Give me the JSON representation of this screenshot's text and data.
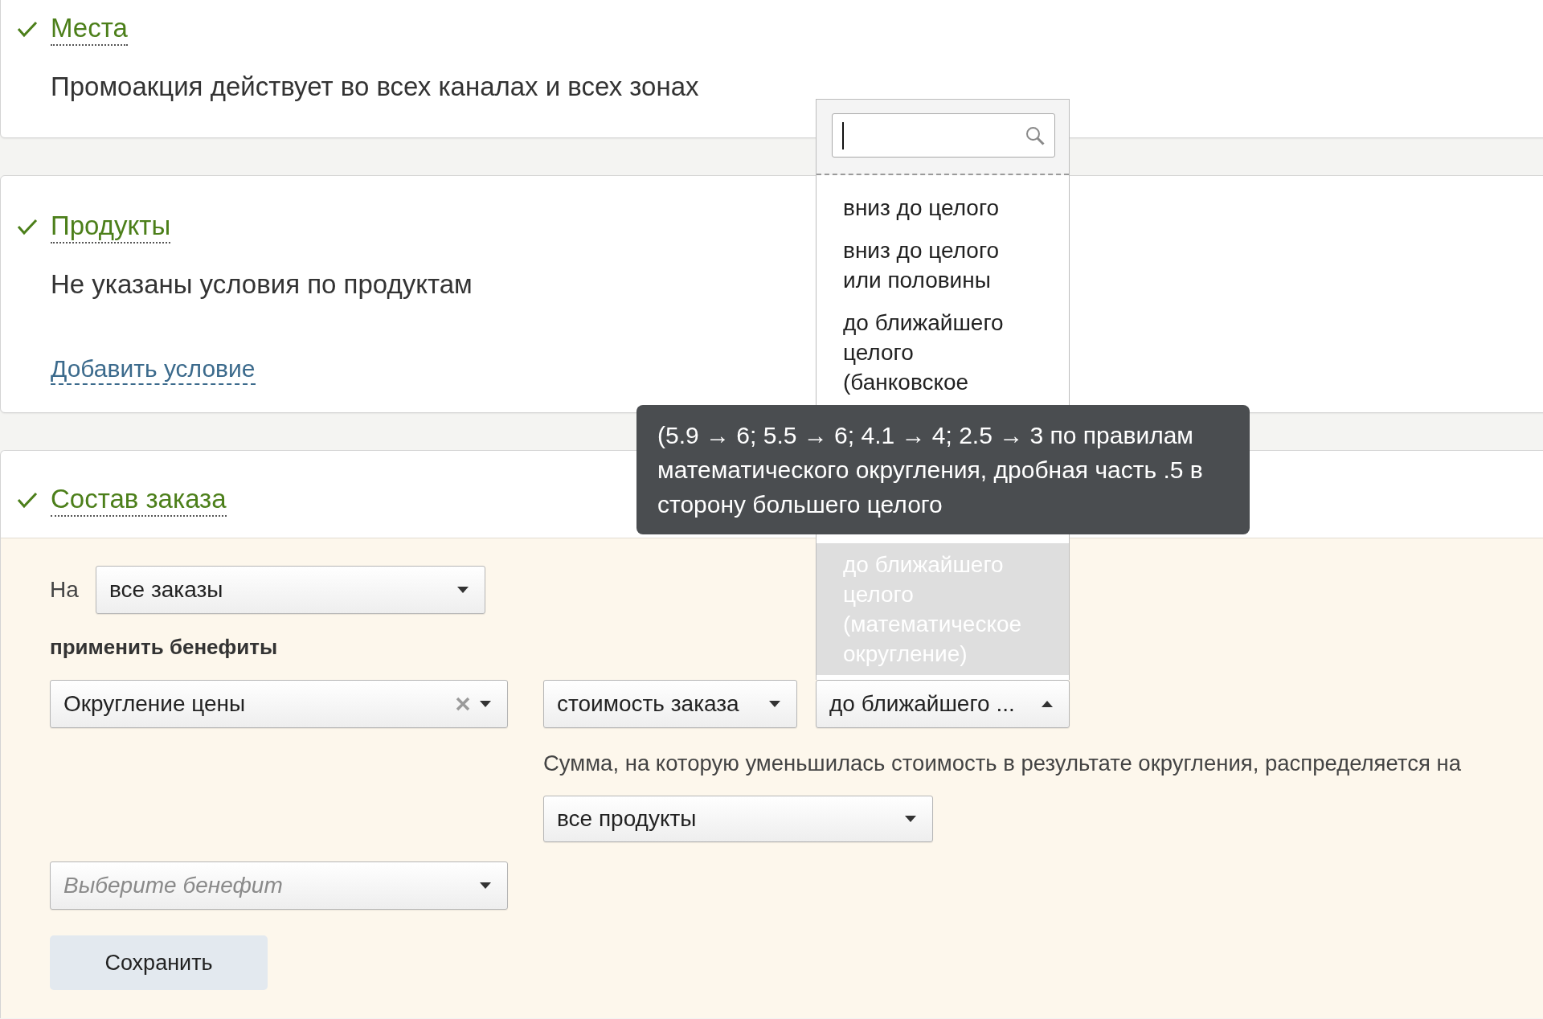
{
  "sections": [
    {
      "title": "Места",
      "complete": true,
      "description": "Промоакция действует во всех каналах и всех зонах"
    },
    {
      "title": "Продукты",
      "complete": true,
      "description": "Не указаны условия по продуктам",
      "link": "Добавить условие"
    },
    {
      "title": "Состав заказа",
      "complete": true,
      "form": {
        "scope_label": "На",
        "scope_select": {
          "value": "все заказы"
        },
        "benefits_label": "применить бенефиты",
        "benefits": [
          {
            "type_select": {
              "value": "Округление цены",
              "clearable": true
            },
            "base_select": {
              "value": "стоимость заказа"
            },
            "rounding_select": {
              "value": "до ближайшего ...",
              "open": true,
              "search": {
                "focused": true
              },
              "options": [
                {
                  "label": "вниз до целого",
                  "selected": false
                },
                {
                  "label": "вниз до целого или половины",
                  "selected": false
                },
                {
                  "label": "до ближайшего целого (банковское",
                  "selected": false
                },
                {
                  "label": "до ближайшего целого (математическое округление)",
                  "selected": true
                }
              ]
            },
            "note": "Сумма, на которую уменьшилась стоимость в результате округления, распределяется на",
            "distribution_select": {
              "value": "все продукты"
            }
          }
        ],
        "new_benefit_select": {
          "placeholder": "Выберите бенефит"
        },
        "save_button": "Сохранить"
      }
    }
  ],
  "tooltip": {
    "text": "(5.9 → 6; 5.5 → 6; 4.1 → 4; 2.5 → 3 по правилам математического округления, дробная часть .5 в сторону большего целого"
  }
}
